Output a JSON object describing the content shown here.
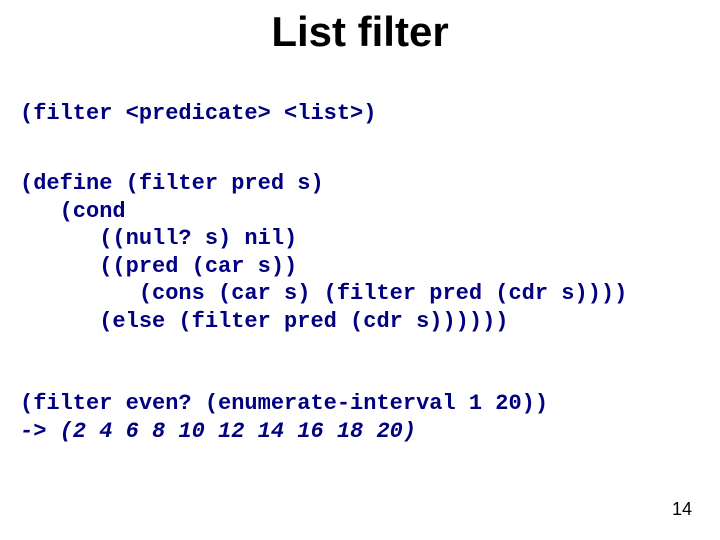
{
  "title": "List filter",
  "code": {
    "signature": "(filter <predicate> <list>)",
    "definition": "(define (filter pred s)\n   (cond\n      ((null? s) nil)\n      ((pred (car s))\n         (cons (car s) (filter pred (cdr s))))\n      (else (filter pred (cdr s))))))",
    "example_call": "(filter even? (enumerate-interval 1 20))",
    "example_result": "-> (2 4 6 8 10 12 14 16 18 20)"
  },
  "page_number": "14"
}
